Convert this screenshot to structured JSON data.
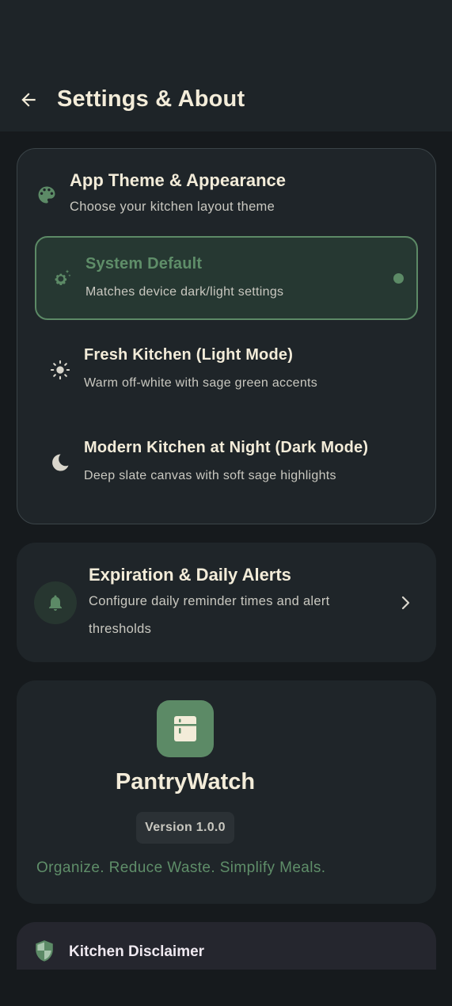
{
  "header": {
    "title": "Settings & About",
    "back_icon": "arrow-left-icon"
  },
  "theme_section": {
    "icon": "palette-icon",
    "title": "App Theme & Appearance",
    "subtitle": "Choose your kitchen layout theme",
    "options": [
      {
        "icon": "settings-auto-icon",
        "title": "System Default",
        "subtitle": "Matches device dark/light settings",
        "selected": true
      },
      {
        "icon": "sun-icon",
        "title": "Fresh Kitchen (Light Mode)",
        "subtitle": "Warm off-white with sage green accents",
        "selected": false
      },
      {
        "icon": "moon-icon",
        "title": "Modern Kitchen at Night (Dark Mode)",
        "subtitle": "Deep slate canvas with soft sage highlights",
        "selected": false
      }
    ]
  },
  "alerts_section": {
    "icon": "bell-icon",
    "title": "Expiration & Daily Alerts",
    "subtitle_line1": "Configure daily reminder times and alert",
    "subtitle_line2": "thresholds",
    "chevron_icon": "chevron-right-icon"
  },
  "about_section": {
    "logo_icon": "fridge-icon",
    "app_name": "PantryWatch",
    "version": "Version 1.0.0",
    "tagline": "Organize. Reduce Waste. Simplify Meals."
  },
  "disclaimer_section": {
    "icon": "shield-icon",
    "title": "Kitchen Disclaimer"
  },
  "colors": {
    "accent": "#5c8a66",
    "background": "#161a1d",
    "card": "#1f2529",
    "text": "#f3ecd9"
  }
}
